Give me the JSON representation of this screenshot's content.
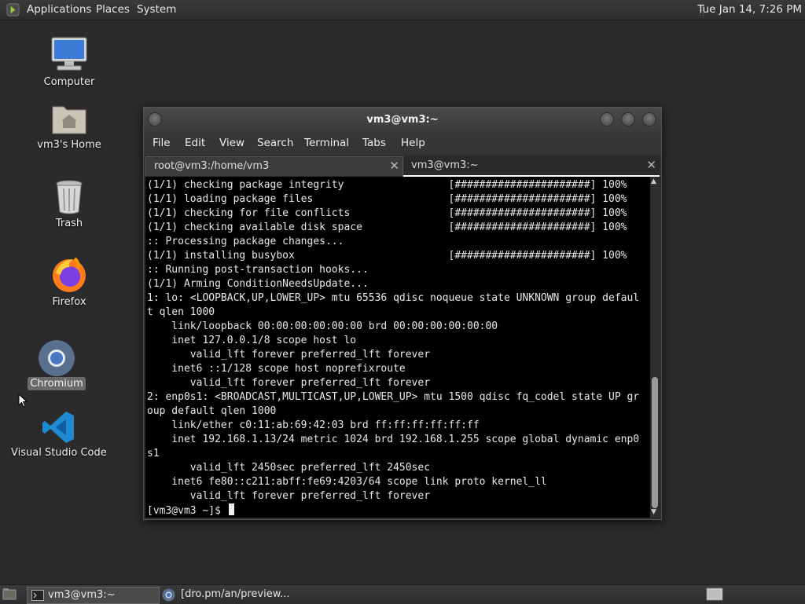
{
  "top_panel": {
    "menus": [
      "Applications",
      "Places",
      "System"
    ],
    "clock": "Tue Jan 14,  7:26 PM"
  },
  "desktop": {
    "icons": [
      {
        "label": "Computer",
        "icon": "computer-icon"
      },
      {
        "label": "vm3's Home",
        "icon": "home-folder-icon"
      },
      {
        "label": "Trash",
        "icon": "trash-icon"
      },
      {
        "label": "Firefox",
        "icon": "firefox-icon"
      },
      {
        "label": "Chromium",
        "icon": "chromium-icon",
        "selected": true
      },
      {
        "label": "Visual Studio Code",
        "icon": "vscode-icon"
      }
    ]
  },
  "terminal": {
    "title": "vm3@vm3:~",
    "menu": [
      "File",
      "Edit",
      "View",
      "Search",
      "Terminal",
      "Tabs",
      "Help"
    ],
    "tabs": [
      {
        "label": "root@vm3:/home/vm3",
        "active": false
      },
      {
        "label": "vm3@vm3:~",
        "active": true
      }
    ],
    "lines": [
      "(1/1) checking package integrity                 [######################] 100%",
      "(1/1) loading package files                      [######################] 100%",
      "(1/1) checking for file conflicts                [######################] 100%",
      "(1/1) checking available disk space              [######################] 100%",
      ":: Processing package changes...",
      "(1/1) installing busybox                         [######################] 100%",
      ":: Running post-transaction hooks...",
      "(1/1) Arming ConditionNeedsUpdate...",
      "1: lo: <LOOPBACK,UP,LOWER_UP> mtu 65536 qdisc noqueue state UNKNOWN group defaul",
      "t qlen 1000",
      "    link/loopback 00:00:00:00:00:00 brd 00:00:00:00:00:00",
      "    inet 127.0.0.1/8 scope host lo",
      "       valid_lft forever preferred_lft forever",
      "    inet6 ::1/128 scope host noprefixroute",
      "       valid_lft forever preferred_lft forever",
      "2: enp0s1: <BROADCAST,MULTICAST,UP,LOWER_UP> mtu 1500 qdisc fq_codel state UP gr",
      "oup default qlen 1000",
      "    link/ether c0:11:ab:69:42:03 brd ff:ff:ff:ff:ff:ff",
      "    inet 192.168.1.13/24 metric 1024 brd 192.168.1.255 scope global dynamic enp0",
      "s1",
      "       valid_lft 2450sec preferred_lft 2450sec",
      "    inet6 fe80::c211:abff:fe69:4203/64 scope link proto kernel_ll",
      "       valid_lft forever preferred_lft forever"
    ],
    "prompt": "[vm3@vm3 ~]$ "
  },
  "taskbar": {
    "tasks": [
      {
        "label": "vm3@vm3:~",
        "icon": "terminal-icon",
        "active": true
      },
      {
        "label": "[dro.pm/an/preview...",
        "icon": "chromium-icon",
        "active": false
      }
    ]
  },
  "colors": {
    "desktop_bg": "#2b2b2b",
    "terminal_bg": "#000000",
    "terminal_fg": "#e8e8e8"
  }
}
